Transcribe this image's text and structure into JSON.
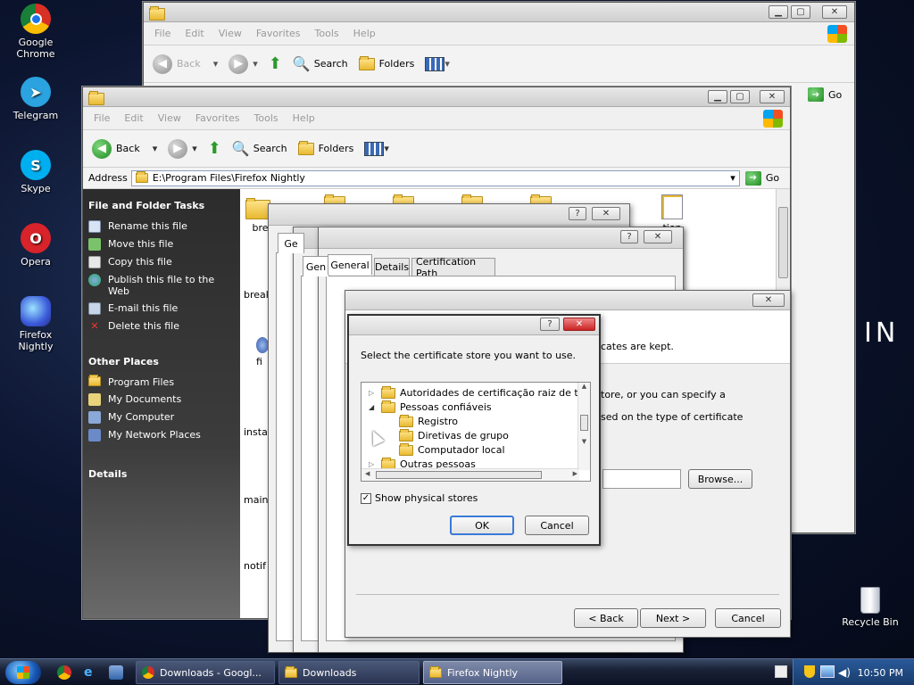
{
  "desktop": {
    "icons": [
      {
        "label": "Google Chrome",
        "icon": "chrome-icon"
      },
      {
        "label": "Telegram",
        "icon": "telegram-icon"
      },
      {
        "label": "Skype",
        "icon": "skype-icon"
      },
      {
        "label": "Opera",
        "icon": "opera-icon"
      },
      {
        "label": "Firefox Nightly",
        "icon": "firefox-nightly-icon"
      },
      {
        "label": "Recycle Bin",
        "icon": "recycle-bin-icon"
      }
    ],
    "bg_text": "IN"
  },
  "back_explorer": {
    "menu": [
      "File",
      "Edit",
      "View",
      "Favorites",
      "Tools",
      "Help"
    ],
    "back": "Back",
    "search": "Search",
    "folders": "Folders",
    "go": "Go"
  },
  "explorer": {
    "menu": [
      "File",
      "Edit",
      "View",
      "Favorites",
      "Tools",
      "Help"
    ],
    "back": "Back",
    "search": "Search",
    "folders": "Folders",
    "address_label": "Address",
    "address": "E:\\Program Files\\Firefox Nightly",
    "go": "Go",
    "tasks_title": "File and Folder Tasks",
    "tasks": [
      "Rename this file",
      "Move this file",
      "Copy this file",
      "Publish this file to the Web",
      "E-mail this file",
      "Delete this file"
    ],
    "other_title": "Other Places",
    "other": [
      "Program Files",
      "My Documents",
      "My Computer",
      "My Network Places"
    ],
    "details_title": "Details",
    "files": [
      "bre",
      "break",
      "fi",
      "insta",
      "main",
      "notif"
    ],
    "file_right": "tion"
  },
  "cert_dialogs": {
    "tab_stub1": "Ge",
    "tab_stub2": "Gen",
    "tabs": [
      "General",
      "Details",
      "Certification Path"
    ]
  },
  "wizard": {
    "text1": "cates are kept.",
    "text2": "tore, or you can specify a",
    "text3": "sed on the type of certificate",
    "browse": "Browse...",
    "back": "< Back",
    "next": "Next >",
    "cancel": "Cancel"
  },
  "store_dialog": {
    "prompt": "Select the certificate store you want to use.",
    "tree": [
      "Autoridades de certificação raiz de terce",
      "Pessoas confiáveis",
      "Registro",
      "Diretivas de grupo",
      "Computador local",
      "Outras pessoas"
    ],
    "show_physical": "Show physical stores",
    "show_physical_checked": true,
    "ok": "OK",
    "cancel": "Cancel"
  },
  "taskbar": {
    "tasks": [
      "Downloads - Googl...",
      "Downloads",
      "Firefox Nightly"
    ],
    "clock": "10:50 PM"
  }
}
